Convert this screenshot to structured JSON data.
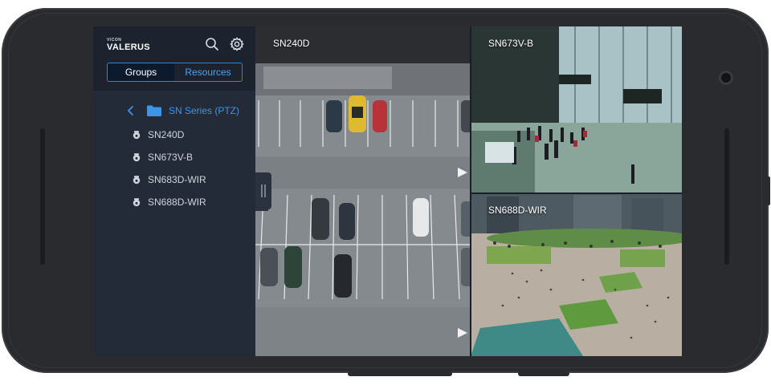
{
  "sidebar": {
    "logo_small": "VICON",
    "logo_main": "VALERUS",
    "tabs": [
      {
        "label": "Groups",
        "active": true
      },
      {
        "label": "Resources",
        "active": false
      }
    ],
    "folder": {
      "label": "SN Series (PTZ)",
      "icon": "folder-icon"
    },
    "cameras": [
      {
        "label": "SN240D",
        "icon": "camera-icon"
      },
      {
        "label": "SN673V-B",
        "icon": "camera-icon"
      },
      {
        "label": "SN683D-WIR",
        "icon": "camera-icon"
      },
      {
        "label": "SN688D-WIR",
        "icon": "camera-icon"
      }
    ]
  },
  "tiles": [
    {
      "label": "SN240D"
    },
    {
      "label": "SN673V-B"
    },
    {
      "label": "SN688D-WIR"
    }
  ],
  "colors": {
    "accent": "#2f86d6",
    "folder_text": "#3d95e8",
    "sidebar_bg": "#232b38",
    "phone_frame": "#2a2b2e"
  }
}
